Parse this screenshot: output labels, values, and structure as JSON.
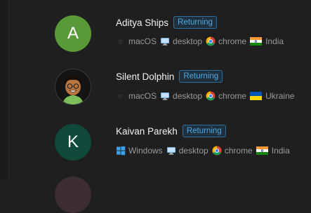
{
  "users": [
    {
      "name": "Aditya Ships",
      "badge": "Returning",
      "avatar": {
        "type": "letter",
        "letter": "A",
        "color": "#5a9a3a"
      },
      "os": {
        "icon": "apple-icon",
        "label": "macOS"
      },
      "device": {
        "icon": "desktop-icon",
        "label": "desktop"
      },
      "browser": {
        "icon": "chrome-icon",
        "label": "chrome"
      },
      "country": {
        "icon": "india-flag-icon",
        "label": "India"
      }
    },
    {
      "name": "Silent Dolphin",
      "badge": "Returning",
      "avatar": {
        "type": "photo"
      },
      "os": {
        "icon": "apple-icon",
        "label": "macOS"
      },
      "device": {
        "icon": "desktop-icon",
        "label": "desktop"
      },
      "browser": {
        "icon": "chrome-icon",
        "label": "chrome"
      },
      "country": {
        "icon": "ukraine-flag-icon",
        "label": "Ukraine"
      }
    },
    {
      "name": "Kaivan Parekh",
      "badge": "Returning",
      "avatar": {
        "type": "letter",
        "letter": "K",
        "color": "#0f4a3a"
      },
      "os": {
        "icon": "windows-icon",
        "label": "Windows"
      },
      "device": {
        "icon": "desktop-icon",
        "label": "desktop"
      },
      "browser": {
        "icon": "chrome-icon",
        "label": "chrome"
      },
      "country": {
        "icon": "india-flag-icon",
        "label": "India"
      }
    }
  ],
  "colors": {
    "background": "#1f1f1f",
    "badge_text": "#4ea9e6",
    "badge_border": "#2f6f9e",
    "meta_text": "#9a9a9a"
  }
}
